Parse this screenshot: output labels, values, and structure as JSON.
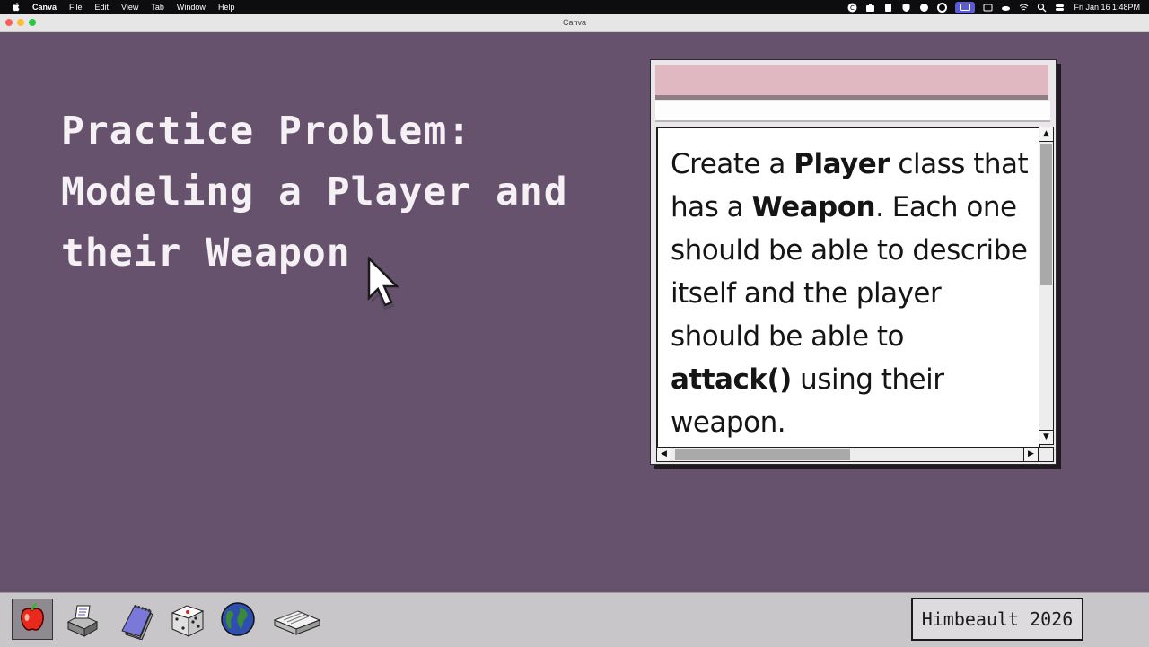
{
  "menubar": {
    "app_name": "Canva",
    "menus": [
      "File",
      "Edit",
      "View",
      "Tab",
      "Window",
      "Help"
    ],
    "datetime": "Fri Jan 16  1:48PM"
  },
  "browser": {
    "title": "Canva"
  },
  "slide": {
    "heading": "Practice Problem:\nModeling a Player and\ntheir Weapon",
    "card": {
      "t1": "Create a ",
      "b1": "Player",
      "t2": " class that has a ",
      "b2": "Weapon",
      "t3": ". Each one should be able to describe itself and the player should be able to ",
      "b3": "attack()",
      "t4": " using their weapon."
    },
    "vertical_scroll_fraction": 0.0,
    "horizontal_scroll_fraction": 0.0
  },
  "dock": {
    "icons": [
      "apple-icon",
      "printer-icon",
      "notepad-icon",
      "dice-icon",
      "globe-icon",
      "scanner-icon"
    ],
    "credit": "Himbeault 2026"
  },
  "colors": {
    "background": "#66526d",
    "window_title": "#dfb8c2",
    "dock": "#c9c6ca"
  }
}
